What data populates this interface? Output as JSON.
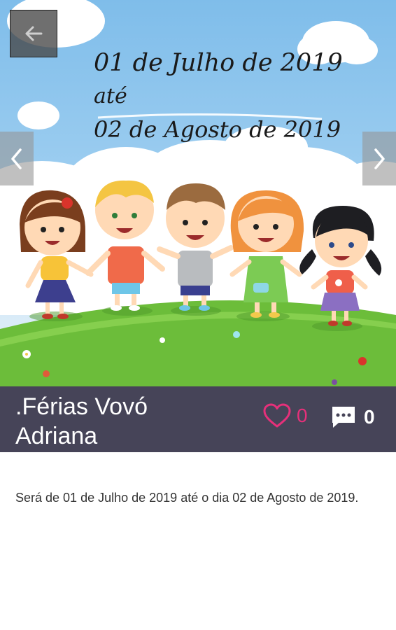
{
  "banner": {
    "date_line1": "01 de Julho de 2019",
    "date_line2": "até",
    "date_line3": "02 de Agosto de 2019"
  },
  "navigation": {
    "back_icon": "arrow-left-icon",
    "prev_icon": "chevron-left-icon",
    "next_icon": "chevron-right-icon"
  },
  "post": {
    "title": ".Férias Vovó Adriana",
    "likes": "0",
    "comments": "0",
    "description": "Será de 01 de Julho de 2019 até o dia 02 de Agosto de 2019."
  },
  "colors": {
    "title_bar": "#464458",
    "like_accent": "#e6307a",
    "sky": "#8ec6ee",
    "grass": "#6cbd3a"
  }
}
